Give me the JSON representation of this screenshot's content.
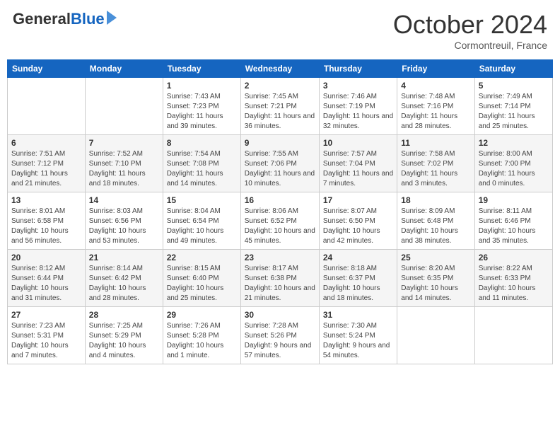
{
  "header": {
    "logo_general": "General",
    "logo_blue": "Blue",
    "month": "October 2024",
    "location": "Cormontreuil, France"
  },
  "days_of_week": [
    "Sunday",
    "Monday",
    "Tuesday",
    "Wednesday",
    "Thursday",
    "Friday",
    "Saturday"
  ],
  "weeks": [
    [
      {
        "num": "",
        "sunrise": "",
        "sunset": "",
        "daylight": ""
      },
      {
        "num": "",
        "sunrise": "",
        "sunset": "",
        "daylight": ""
      },
      {
        "num": "1",
        "sunrise": "Sunrise: 7:43 AM",
        "sunset": "Sunset: 7:23 PM",
        "daylight": "Daylight: 11 hours and 39 minutes."
      },
      {
        "num": "2",
        "sunrise": "Sunrise: 7:45 AM",
        "sunset": "Sunset: 7:21 PM",
        "daylight": "Daylight: 11 hours and 36 minutes."
      },
      {
        "num": "3",
        "sunrise": "Sunrise: 7:46 AM",
        "sunset": "Sunset: 7:19 PM",
        "daylight": "Daylight: 11 hours and 32 minutes."
      },
      {
        "num": "4",
        "sunrise": "Sunrise: 7:48 AM",
        "sunset": "Sunset: 7:16 PM",
        "daylight": "Daylight: 11 hours and 28 minutes."
      },
      {
        "num": "5",
        "sunrise": "Sunrise: 7:49 AM",
        "sunset": "Sunset: 7:14 PM",
        "daylight": "Daylight: 11 hours and 25 minutes."
      }
    ],
    [
      {
        "num": "6",
        "sunrise": "Sunrise: 7:51 AM",
        "sunset": "Sunset: 7:12 PM",
        "daylight": "Daylight: 11 hours and 21 minutes."
      },
      {
        "num": "7",
        "sunrise": "Sunrise: 7:52 AM",
        "sunset": "Sunset: 7:10 PM",
        "daylight": "Daylight: 11 hours and 18 minutes."
      },
      {
        "num": "8",
        "sunrise": "Sunrise: 7:54 AM",
        "sunset": "Sunset: 7:08 PM",
        "daylight": "Daylight: 11 hours and 14 minutes."
      },
      {
        "num": "9",
        "sunrise": "Sunrise: 7:55 AM",
        "sunset": "Sunset: 7:06 PM",
        "daylight": "Daylight: 11 hours and 10 minutes."
      },
      {
        "num": "10",
        "sunrise": "Sunrise: 7:57 AM",
        "sunset": "Sunset: 7:04 PM",
        "daylight": "Daylight: 11 hours and 7 minutes."
      },
      {
        "num": "11",
        "sunrise": "Sunrise: 7:58 AM",
        "sunset": "Sunset: 7:02 PM",
        "daylight": "Daylight: 11 hours and 3 minutes."
      },
      {
        "num": "12",
        "sunrise": "Sunrise: 8:00 AM",
        "sunset": "Sunset: 7:00 PM",
        "daylight": "Daylight: 11 hours and 0 minutes."
      }
    ],
    [
      {
        "num": "13",
        "sunrise": "Sunrise: 8:01 AM",
        "sunset": "Sunset: 6:58 PM",
        "daylight": "Daylight: 10 hours and 56 minutes."
      },
      {
        "num": "14",
        "sunrise": "Sunrise: 8:03 AM",
        "sunset": "Sunset: 6:56 PM",
        "daylight": "Daylight: 10 hours and 53 minutes."
      },
      {
        "num": "15",
        "sunrise": "Sunrise: 8:04 AM",
        "sunset": "Sunset: 6:54 PM",
        "daylight": "Daylight: 10 hours and 49 minutes."
      },
      {
        "num": "16",
        "sunrise": "Sunrise: 8:06 AM",
        "sunset": "Sunset: 6:52 PM",
        "daylight": "Daylight: 10 hours and 45 minutes."
      },
      {
        "num": "17",
        "sunrise": "Sunrise: 8:07 AM",
        "sunset": "Sunset: 6:50 PM",
        "daylight": "Daylight: 10 hours and 42 minutes."
      },
      {
        "num": "18",
        "sunrise": "Sunrise: 8:09 AM",
        "sunset": "Sunset: 6:48 PM",
        "daylight": "Daylight: 10 hours and 38 minutes."
      },
      {
        "num": "19",
        "sunrise": "Sunrise: 8:11 AM",
        "sunset": "Sunset: 6:46 PM",
        "daylight": "Daylight: 10 hours and 35 minutes."
      }
    ],
    [
      {
        "num": "20",
        "sunrise": "Sunrise: 8:12 AM",
        "sunset": "Sunset: 6:44 PM",
        "daylight": "Daylight: 10 hours and 31 minutes."
      },
      {
        "num": "21",
        "sunrise": "Sunrise: 8:14 AM",
        "sunset": "Sunset: 6:42 PM",
        "daylight": "Daylight: 10 hours and 28 minutes."
      },
      {
        "num": "22",
        "sunrise": "Sunrise: 8:15 AM",
        "sunset": "Sunset: 6:40 PM",
        "daylight": "Daylight: 10 hours and 25 minutes."
      },
      {
        "num": "23",
        "sunrise": "Sunrise: 8:17 AM",
        "sunset": "Sunset: 6:38 PM",
        "daylight": "Daylight: 10 hours and 21 minutes."
      },
      {
        "num": "24",
        "sunrise": "Sunrise: 8:18 AM",
        "sunset": "Sunset: 6:37 PM",
        "daylight": "Daylight: 10 hours and 18 minutes."
      },
      {
        "num": "25",
        "sunrise": "Sunrise: 8:20 AM",
        "sunset": "Sunset: 6:35 PM",
        "daylight": "Daylight: 10 hours and 14 minutes."
      },
      {
        "num": "26",
        "sunrise": "Sunrise: 8:22 AM",
        "sunset": "Sunset: 6:33 PM",
        "daylight": "Daylight: 10 hours and 11 minutes."
      }
    ],
    [
      {
        "num": "27",
        "sunrise": "Sunrise: 7:23 AM",
        "sunset": "Sunset: 5:31 PM",
        "daylight": "Daylight: 10 hours and 7 minutes."
      },
      {
        "num": "28",
        "sunrise": "Sunrise: 7:25 AM",
        "sunset": "Sunset: 5:29 PM",
        "daylight": "Daylight: 10 hours and 4 minutes."
      },
      {
        "num": "29",
        "sunrise": "Sunrise: 7:26 AM",
        "sunset": "Sunset: 5:28 PM",
        "daylight": "Daylight: 10 hours and 1 minute."
      },
      {
        "num": "30",
        "sunrise": "Sunrise: 7:28 AM",
        "sunset": "Sunset: 5:26 PM",
        "daylight": "Daylight: 9 hours and 57 minutes."
      },
      {
        "num": "31",
        "sunrise": "Sunrise: 7:30 AM",
        "sunset": "Sunset: 5:24 PM",
        "daylight": "Daylight: 9 hours and 54 minutes."
      },
      {
        "num": "",
        "sunrise": "",
        "sunset": "",
        "daylight": ""
      },
      {
        "num": "",
        "sunrise": "",
        "sunset": "",
        "daylight": ""
      }
    ]
  ]
}
